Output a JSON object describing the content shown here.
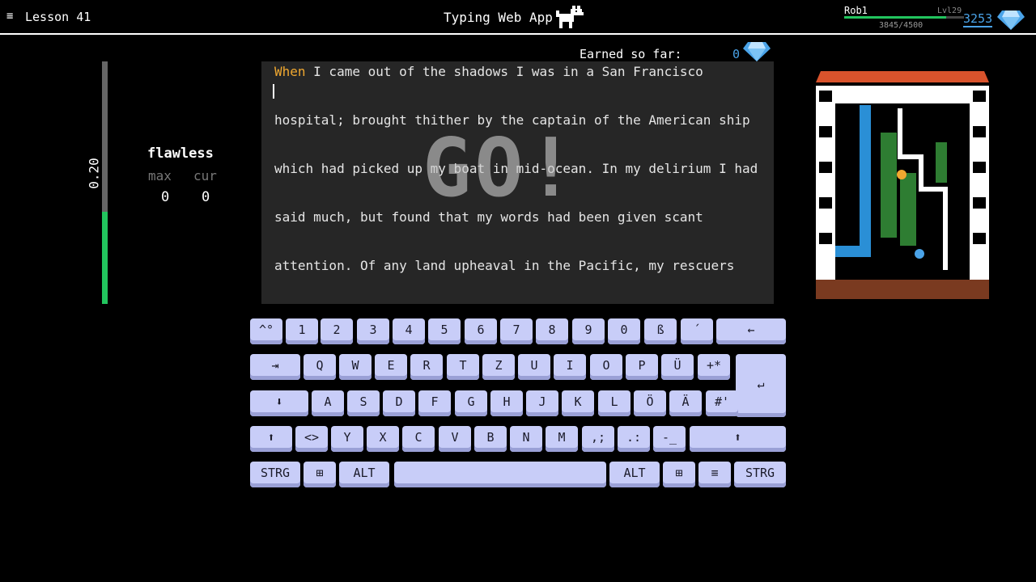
{
  "header": {
    "menu_icon": "≡",
    "lesson": "Lesson 41",
    "app_title": "Typing Web App",
    "user": {
      "name": "Rob1",
      "level": "Lvl29",
      "xp": "3845/4500",
      "xp_progress": 0.854,
      "gems": "3253"
    }
  },
  "stats": {
    "speed": "0.20",
    "speed_level": 0.38,
    "flawless_label": "flawless",
    "max_label": "max",
    "cur_label": "cur",
    "max_value": "0",
    "cur_value": "0"
  },
  "earned": {
    "label": "Earned so far:",
    "value": "0"
  },
  "text": {
    "current_word": "When",
    "line1_rest": " I came out of the shadows I was in a San Francisco",
    "line2": "hospital; brought thither by the captain of the American ship",
    "line3": "which had picked up my boat in mid-ocean. In my delirium I had",
    "line4": "said much, but found that my words had been given scant",
    "line5": "attention. Of any land upheaval in the Pacific, my rescuers",
    "overlay": "GO!"
  },
  "keyboard": {
    "row1": [
      "^°",
      "1",
      "2",
      "3",
      "4",
      "5",
      "6",
      "7",
      "8",
      "9",
      "0",
      "ß",
      "´",
      "←"
    ],
    "row2": [
      "⇥",
      "Q",
      "W",
      "E",
      "R",
      "T",
      "Z",
      "U",
      "I",
      "O",
      "P",
      "Ü",
      "+*",
      "↵"
    ],
    "row3": [
      "⬇",
      "A",
      "S",
      "D",
      "F",
      "G",
      "H",
      "J",
      "K",
      "L",
      "Ö",
      "Ä",
      "#'"
    ],
    "row4": [
      "⬆",
      "<>",
      "Y",
      "X",
      "C",
      "V",
      "B",
      "N",
      "M",
      ",;",
      ".:",
      "-_",
      "⬆"
    ],
    "row5": [
      "STRG",
      "⊞",
      "ALT",
      "",
      "ALT",
      "⊞",
      "≡",
      "STRG"
    ]
  },
  "colors": {
    "accent_blue": "#4aa3e8",
    "progress_green": "#22c55e",
    "current_word": "#f0a830",
    "key_bg": "#c8cdf8"
  }
}
